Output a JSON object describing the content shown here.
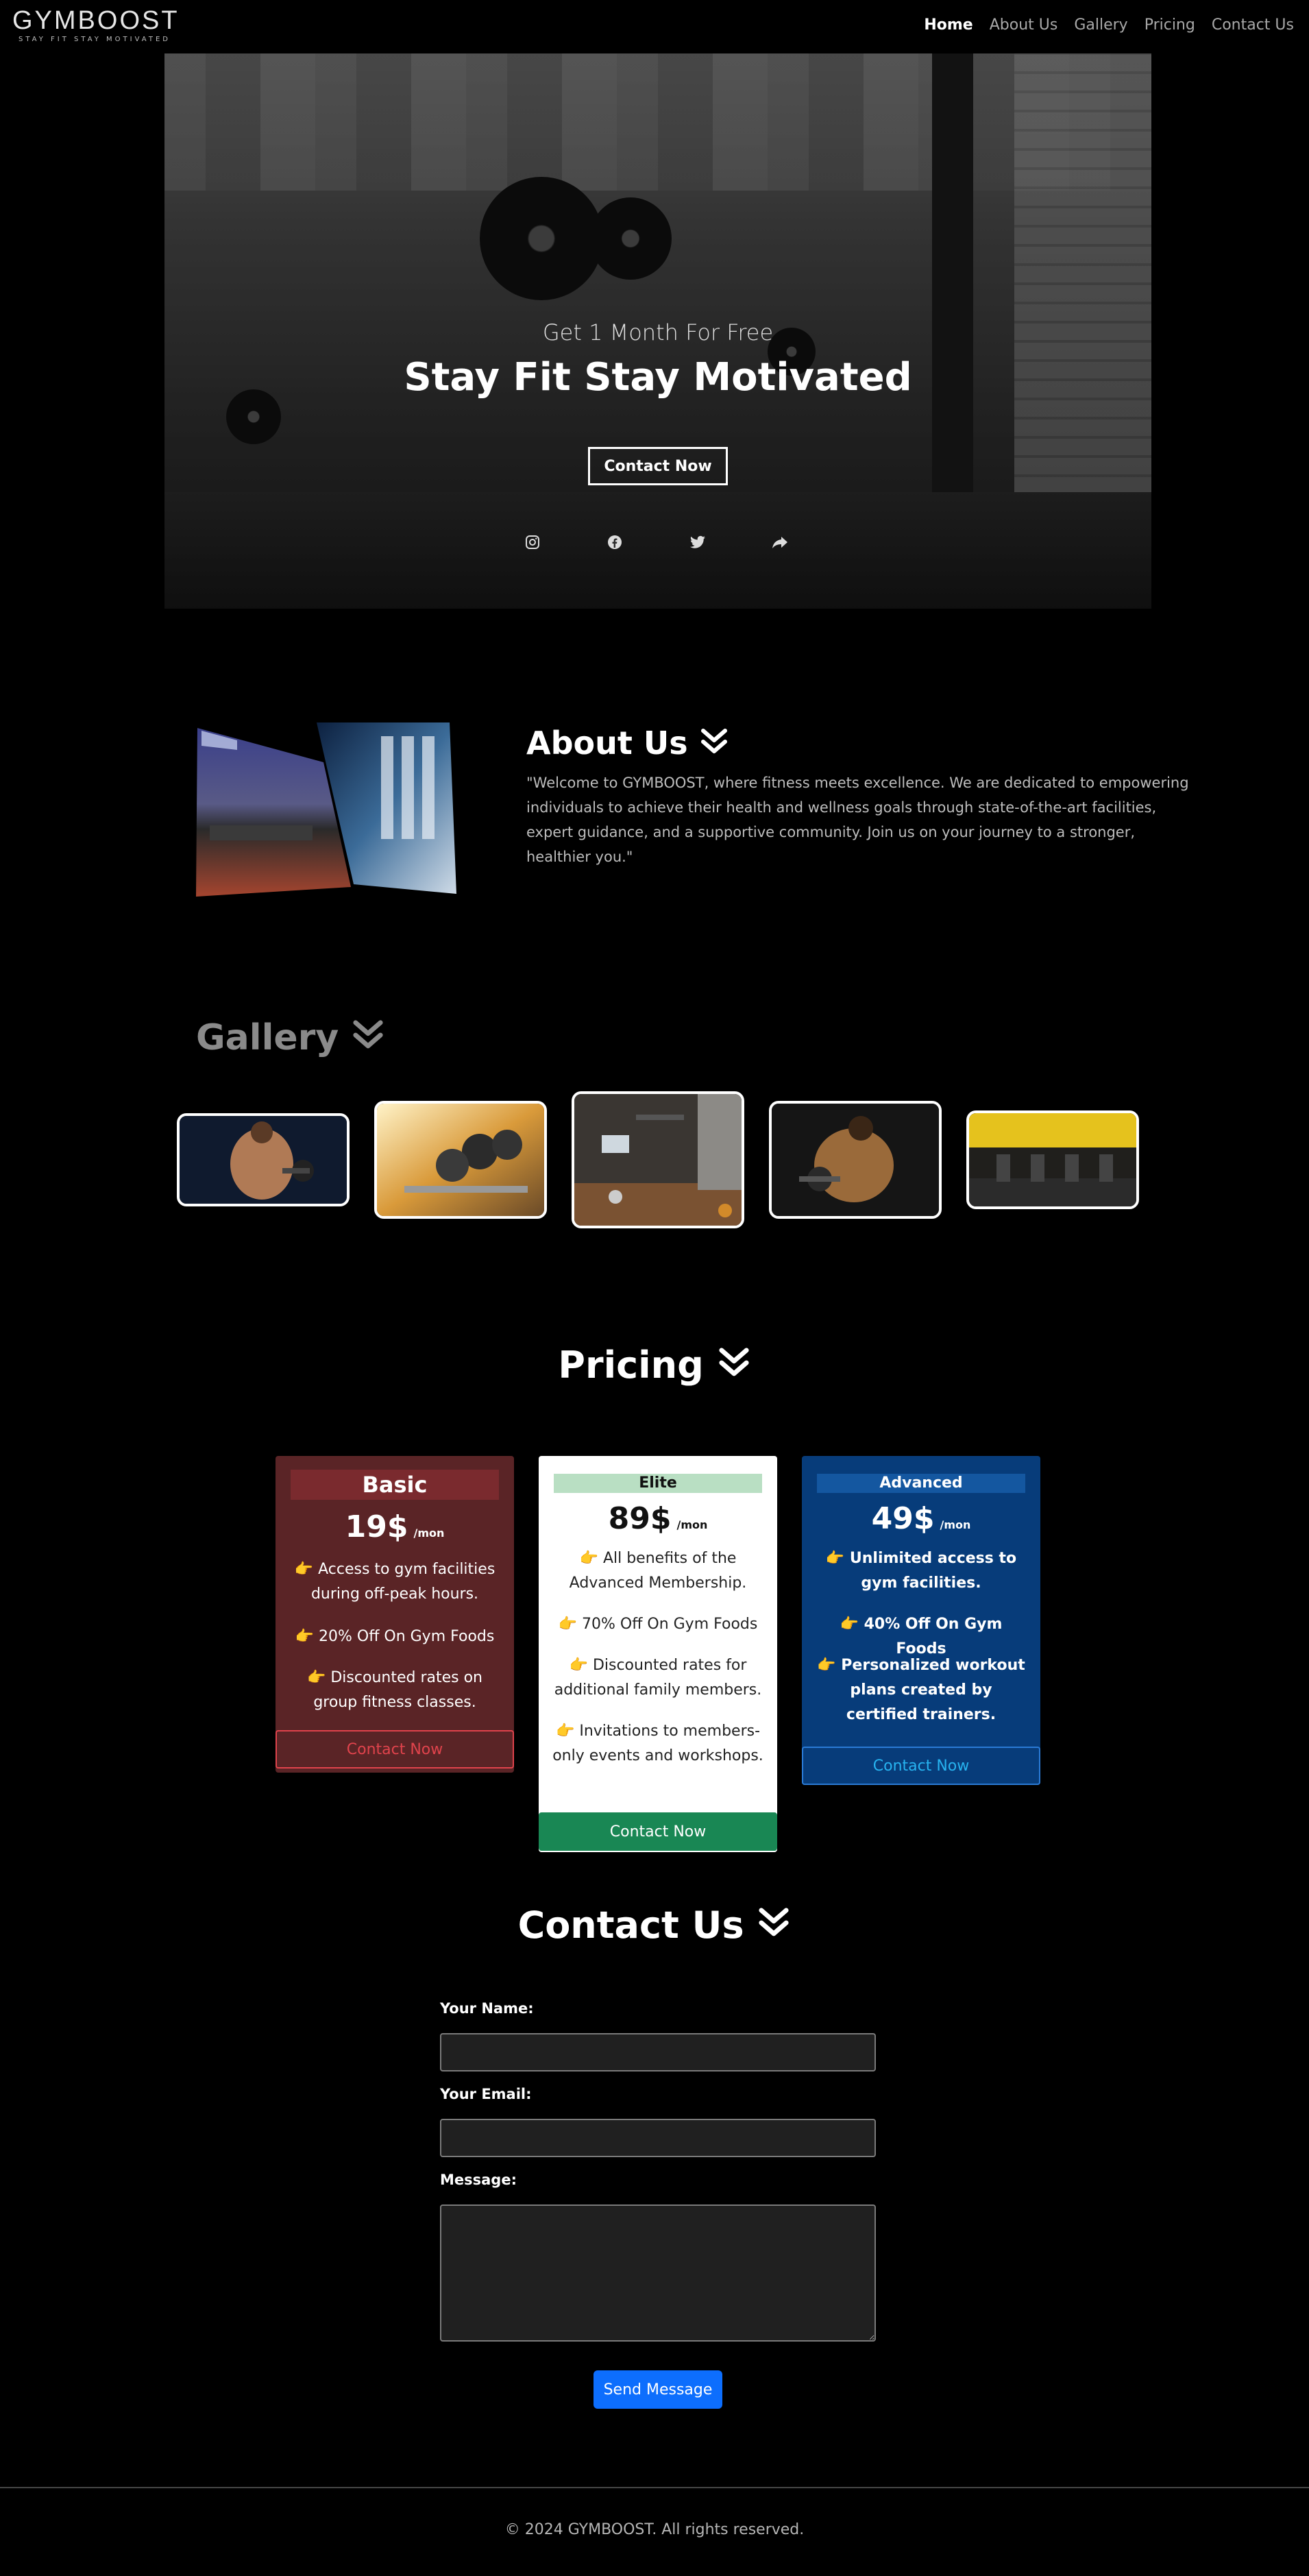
{
  "nav": {
    "brand": "GYMBOOST",
    "tagline": "STAY FIT STAY MOTIVATED",
    "links": [
      "Home",
      "About Us",
      "Gallery",
      "Pricing",
      "Contact Us"
    ]
  },
  "hero": {
    "kicker": "Get 1 Month For Free",
    "headline": "Stay Fit Stay Motivated",
    "cta": "Contact Now",
    "social_icons": [
      "instagram-icon",
      "facebook-icon",
      "twitter-icon",
      "share-icon"
    ]
  },
  "about": {
    "title": "About Us",
    "text": "\"Welcome to GYMBOOST, where fitness meets excellence. We are dedicated to empowering individuals to achieve their health and wellness goals through state-of-the-art facilities, expert guidance, and a supportive community. Join us on your journey to a stronger, healthier you.\""
  },
  "gallery": {
    "title": "Gallery"
  },
  "pricing": {
    "title": "Pricing",
    "plans": [
      {
        "name": "Basic",
        "price": "19$",
        "period": "/mon",
        "features": [
          "👉 Access to gym facilities during off-peak hours.",
          "👉 20% Off On Gym Foods",
          "👉 Discounted rates on group fitness classes."
        ],
        "button": "Contact Now",
        "colors": {
          "bg": "#5a2426",
          "header": "#7a2a2e",
          "button_text": "#e0434c",
          "button_border": "#e0434c"
        }
      },
      {
        "name": "Elite",
        "price": "89$",
        "period": "/mon",
        "features": [
          "👉 All benefits of the Advanced Membership.",
          "👉 70% Off On Gym Foods",
          "👉 Discounted rates for additional family members.",
          "👉 Invitations to members-only events and workshops."
        ],
        "button": "Contact Now",
        "colors": {
          "bg": "#ffffff",
          "header": "#b9dfc3",
          "button_bg": "#198754"
        }
      },
      {
        "name": "Advanced",
        "price": "49$",
        "period": "/mon",
        "features": [
          "👉 Unlimited access to gym facilities.",
          "👉 40% Off On Gym Foods",
          "👉 Personalized workout plans created by certified trainers."
        ],
        "button": "Contact Now",
        "colors": {
          "bg": "#073c7a",
          "header": "#1457a0",
          "button_text": "#27b3f0",
          "button_border": "#2a7bd6"
        }
      }
    ]
  },
  "contact": {
    "title": "Contact Us",
    "name_label": "Your Name:",
    "email_label": "Your Email:",
    "message_label": "Message:",
    "name_value": "",
    "email_value": "",
    "message_value": "",
    "send_button": "Send Message"
  },
  "footer": {
    "text": "© 2024 GYMBOOST. All rights reserved."
  },
  "colors": {
    "background": "#000000",
    "accent": "#0d6efd"
  }
}
